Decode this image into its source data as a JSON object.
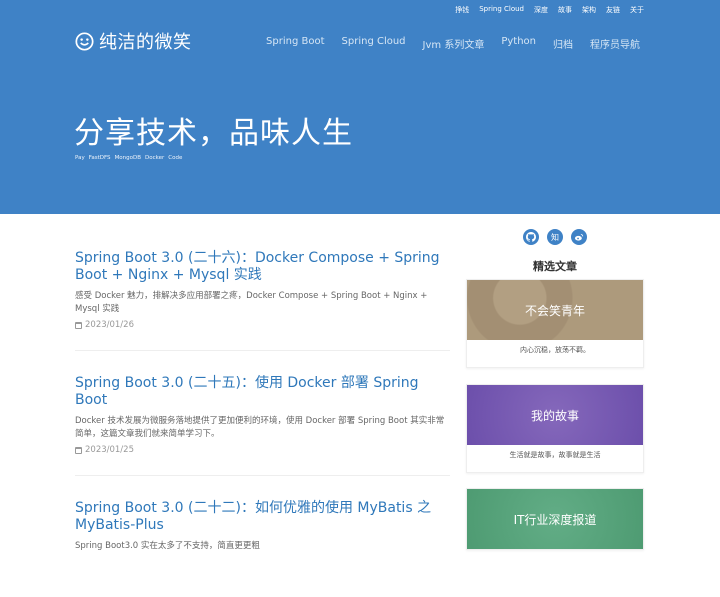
{
  "topbar": {
    "items": [
      "挣钱",
      "Spring Cloud",
      "深度",
      "故事",
      "架构",
      "友链",
      "关于"
    ]
  },
  "site": {
    "name": "纯洁的微笑",
    "slogan": "分享技术，品味人生"
  },
  "nav": {
    "items": [
      "Spring Boot",
      "Spring Cloud",
      "Jvm 系列文章",
      "Python",
      "归档",
      "程序员导航"
    ]
  },
  "tags": [
    "Pay",
    "FastDFS",
    "MongoDB",
    "Docker",
    "Code"
  ],
  "posts": [
    {
      "title": "Spring Boot 3.0 (二十六)：Docker Compose + Spring Boot + Nginx + Mysql 实践",
      "summary": "感受 Docker 魅力，排解决多应用部署之疼，Docker Compose + Spring Boot + Nginx + Mysql 实践",
      "date": "2023/01/26"
    },
    {
      "title": "Spring Boot 3.0 (二十五)：使用 Docker 部署 Spring Boot",
      "summary": "Docker 技术发展为微服务落地提供了更加便利的环境，使用 Docker 部署 Spring Boot 其实非常简单，这篇文章我们就来简单学习下。",
      "date": "2023/01/25"
    },
    {
      "title": "Spring Boot 3.0 (二十二)：如何优雅的使用 MyBatis 之 MyBatis-Plus",
      "summary": "Spring Boot3.0 实在太多了不支持，简直更更粗",
      "date": ""
    }
  ],
  "sidebar": {
    "social": [
      "github-icon",
      "zhihu-icon",
      "weibo-icon"
    ],
    "zhihu_label": "知",
    "title": "精选文章",
    "cards": [
      {
        "title": "不会笑青年",
        "desc": "内心沉稳，放荡不羁。",
        "color": "#a8957a"
      },
      {
        "title": "我的故事",
        "desc": "生活就是故事，故事就是生活",
        "color": "#7459b3"
      },
      {
        "title": "IT行业深度报道",
        "desc": "",
        "color": "#58a47c"
      }
    ]
  }
}
